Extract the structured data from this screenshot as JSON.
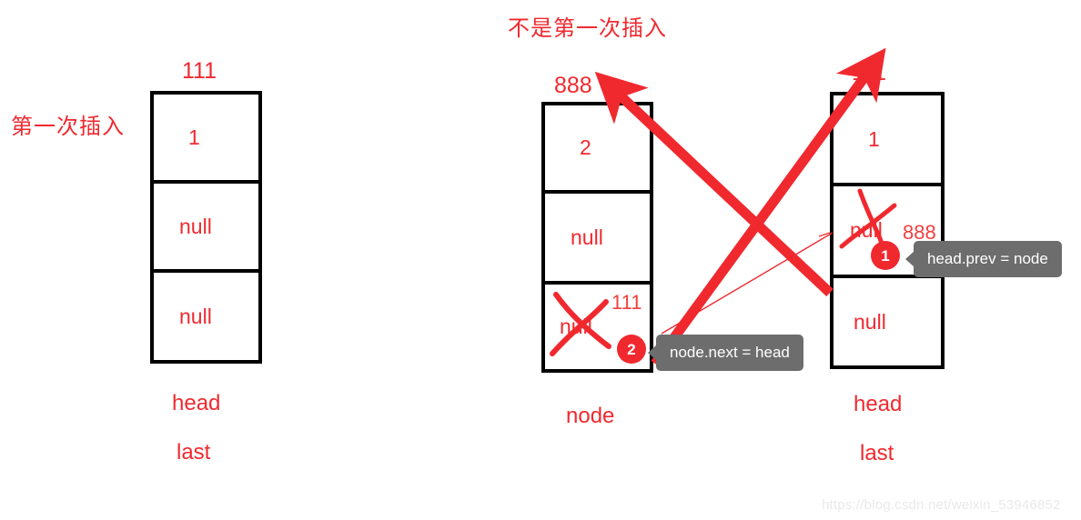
{
  "figure": {
    "title": "不是第一次插入",
    "left_caption": "第一次插入",
    "watermark": "https://blog.csdn.net/weixin_53946852",
    "accent_color": "#f0292f",
    "tooltip_color": "#6d6d6d",
    "box_border_color": "#000000",
    "background_color": "#ffffff"
  },
  "first_insert": {
    "address_label": "111",
    "cells": [
      {
        "value": "1"
      },
      {
        "value": "null"
      },
      {
        "value": "null"
      }
    ],
    "pointers": [
      "head",
      "last"
    ]
  },
  "not_first_insert": {
    "node": {
      "address_label": "888",
      "name": "node",
      "cells": [
        {
          "value": "2",
          "struck": false,
          "new_value": ""
        },
        {
          "value": "null",
          "struck": false,
          "new_value": ""
        },
        {
          "value": "null",
          "struck": true,
          "new_value": "111"
        }
      ],
      "step_badge": "2"
    },
    "head": {
      "address_label": "111",
      "pointers": [
        "head",
        "last"
      ],
      "cells": [
        {
          "value": "1",
          "struck": false,
          "new_value": ""
        },
        {
          "value": "null",
          "struck": true,
          "new_value": "888"
        },
        {
          "value": "null",
          "struck": false,
          "new_value": ""
        }
      ],
      "step_badge": "1"
    },
    "annotations": [
      {
        "id": "step1",
        "text": "head.prev = node",
        "badge": "1"
      },
      {
        "id": "step2",
        "text": "node.next = head",
        "badge": "2"
      }
    ],
    "arrows": [
      {
        "from": "head.prev cell",
        "to": "888 (node address)"
      },
      {
        "from": "node.next cell",
        "to": "111 (head address)"
      }
    ]
  }
}
